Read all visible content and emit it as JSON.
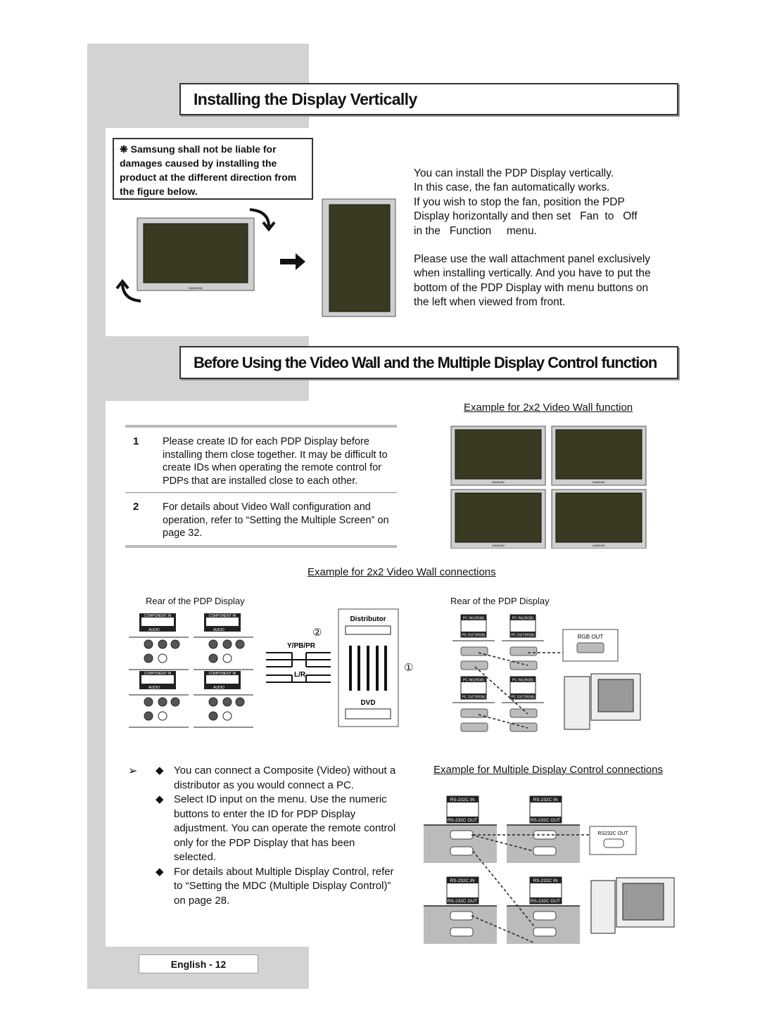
{
  "section1": {
    "title": "Installing the Display Vertically",
    "warning": "❋ Samsung shall not be liable for damages caused by installing the product at the different direction from the figure below.",
    "paragraph1_lines": [
      "You can install the PDP Display vertically.",
      "In this case, the fan automatically works.",
      "If you wish to stop the fan, position the PDP",
      "Display horizontally and then set   Fan  to   Off",
      "in the   Function     menu."
    ],
    "paragraph2_lines": [
      "Please use the wall attachment panel exclusively",
      "when installing vertically. And you have to put the",
      "bottom of the PDP Display with menu buttons on",
      "the left when viewed from front."
    ],
    "brand": "SAMSUNG"
  },
  "section2": {
    "title": "Before Using the Video Wall and the Multiple Display Control function",
    "videowall_caption": "Example for 2x2 Video Wall function",
    "items": [
      {
        "num": "1",
        "text": "Please create ID for each PDP Display before installing them close together. It may be difficult to create IDs when operating the remote control for PDPs that are installed close to each other."
      },
      {
        "num": "2",
        "text": "For details about Video Wall configuration and operation, refer to “Setting the Multiple Screen” on page 32."
      }
    ],
    "connections_caption": "Example for 2x2 Video Wall connections",
    "rear_label": "Rear of the PDP Display",
    "component_in": "COMPONENT IN",
    "audio": "AUDIO",
    "ypbpr": "Y/PB/PR",
    "lr": "L/R",
    "distributor": "Distributor",
    "dvd": "DVD",
    "marker1": "①",
    "marker2": "②",
    "pc_in": "PC IN1(RGB)",
    "pc_out": "PC OUT(RGB)",
    "rgb_out": "RGB OUT",
    "note_arrow": "➢",
    "bullet_icon": "◆",
    "bullets": [
      "You can connect a Composite (Video) without a distributor as you would connect a PC.",
      "Select ID input on the menu. Use the numeric buttons to enter the ID for PDP Display adjustment. You can operate the remote control only for the PDP Display that has been selected.",
      "For details about Multiple Display Control, refer to “Setting the MDC (Multiple Display Control)” on page 28."
    ],
    "mdc_caption": "Example for Multiple Display Control connections",
    "rs_in": "RS-232C IN",
    "rs_out": "RS-232C OUT",
    "rs_pc_out": "RS232C OUT"
  },
  "footer": {
    "page_label": "English - 12"
  }
}
